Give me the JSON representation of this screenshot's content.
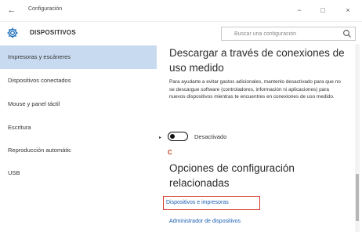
{
  "window": {
    "title": "Configuración",
    "back_glyph": "←",
    "minimize_glyph": "−",
    "maximize_glyph": "□",
    "close_glyph": "×"
  },
  "header": {
    "section_title": "DISPOSITIVOS",
    "search_placeholder": "Buscar una configuración"
  },
  "sidebar": {
    "items": [
      {
        "label": "Impresoras y escáneres",
        "active": true
      },
      {
        "label": "Dispositivos conectados",
        "active": false
      },
      {
        "label": "Mouse y panel táctil",
        "active": false
      },
      {
        "label": "Escritura",
        "active": false
      },
      {
        "label": "Reproducción automátic",
        "active": false
      },
      {
        "label": "USB",
        "active": false
      }
    ]
  },
  "content": {
    "metered_heading": "Descargar a través de conexiones de uso medido",
    "metered_description": "Para ayudarte a evitar gastos adicionales, mantenlo desactivado para que no se descargue software (controladores, información ni aplicaciones) para nuevos dispositivos mientras te encuentres en conexiones de uso medido.",
    "toggle_state_label": "Desactivado",
    "toggle_on": false,
    "annotation_letter": "C",
    "related_heading": "Opciones de configuración relacionadas",
    "links": [
      {
        "label": "Dispositivos e impresoras",
        "highlighted": true
      },
      {
        "label": "Administrador de dispositivos",
        "highlighted": false
      }
    ]
  },
  "colors": {
    "active_item_bg": "#c8daf0",
    "link": "#1a5fb4",
    "highlight_box": "#d23b2a",
    "annotation": "#d03a1b"
  },
  "icons": {
    "header_icon": "gear-icon",
    "search_icon": "search-icon",
    "back_icon": "back-arrow-icon"
  }
}
